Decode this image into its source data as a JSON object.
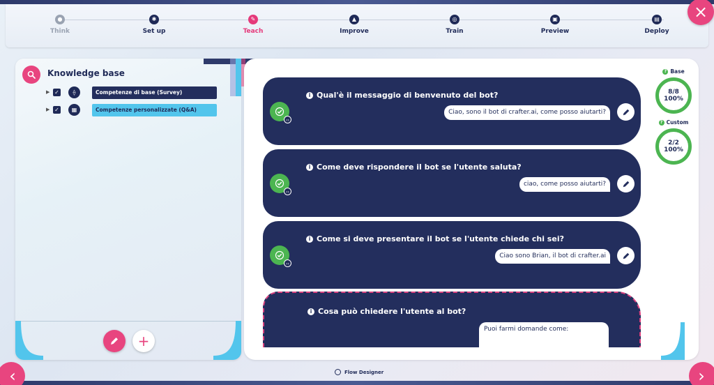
{
  "stepper": {
    "steps": [
      {
        "label": "Think",
        "icon": "bulb-icon",
        "state": "disabled"
      },
      {
        "label": "Set up",
        "icon": "gear-icon",
        "state": "normal"
      },
      {
        "label": "Teach",
        "icon": "pencil-icon",
        "state": "active"
      },
      {
        "label": "Improve",
        "icon": "trend-icon",
        "state": "normal"
      },
      {
        "label": "Train",
        "icon": "brain-icon",
        "state": "normal"
      },
      {
        "label": "Preview",
        "icon": "screen-icon",
        "state": "normal"
      },
      {
        "label": "Deploy",
        "icon": "rocket-icon",
        "state": "normal"
      }
    ]
  },
  "knowledge_base": {
    "title": "Knowledge base",
    "items": [
      {
        "label": "Competenze di base (Survey)",
        "checked": true,
        "style": "dark"
      },
      {
        "label": "Competenze personalizzate (Q&A)",
        "checked": true,
        "style": "light"
      }
    ]
  },
  "cards": [
    {
      "question": "Qual'è il messaggio di benvenuto del bot?",
      "answer": "Ciao, sono il bot di crafter.ai, come posso aiutarti?",
      "status": "done"
    },
    {
      "question": "Come deve rispondere il bot se l'utente saluta?",
      "answer": "ciao, come posso aiutarti?",
      "status": "done"
    },
    {
      "question": "Come si deve presentare il bot se l'utente chiede chi sei?",
      "answer": "Ciao sono Brian, il bot di crafter.ai",
      "status": "done"
    },
    {
      "question": "Cosa può chiedere l'utente al bot?",
      "answer": "Puoi farmi domande come:",
      "status": "pending"
    }
  ],
  "stats": {
    "base": {
      "label": "Base",
      "count": "8/8",
      "percent": "100%"
    },
    "custom": {
      "label": "Custom",
      "count": "2/2",
      "percent": "100%"
    }
  },
  "footer": {
    "label": "Flow Designer"
  },
  "colors": {
    "primary": "#232e5d",
    "accent": "#e8457f",
    "success": "#4cb551",
    "highlight": "#52c5ec"
  }
}
